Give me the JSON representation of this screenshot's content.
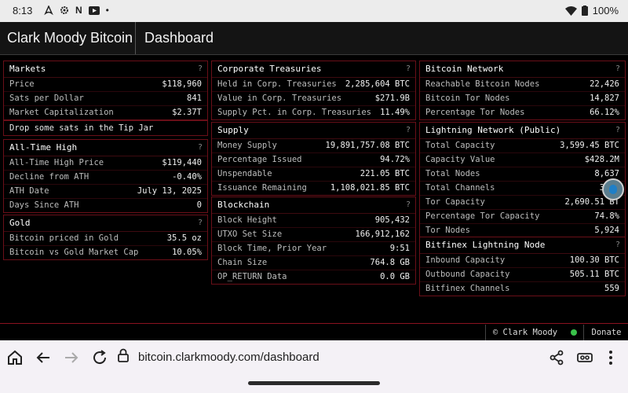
{
  "status_bar": {
    "time": "8:13",
    "left_icons": [
      "airbnb-icon",
      "settings-icon",
      "n-icon",
      "youtube-icon",
      "dot-icon"
    ],
    "battery": "100%"
  },
  "header": {
    "brand": "Clark Moody Bitcoin",
    "page": "Dashboard"
  },
  "panels": {
    "markets": {
      "title": "Markets",
      "help": "?",
      "rows": [
        {
          "label": "Price",
          "value": "$118,960"
        },
        {
          "label": "Sats per Dollar",
          "value": "841"
        },
        {
          "label": "Market Capitalization",
          "value": "$2.37T"
        }
      ]
    },
    "tip_jar": "Drop some sats in the Tip Jar",
    "ath": {
      "title": "All-Time High",
      "help": "?",
      "rows": [
        {
          "label": "All-Time High Price",
          "value": "$119,440"
        },
        {
          "label": "Decline from ATH",
          "value": "-0.40%"
        },
        {
          "label": "ATH Date",
          "value": "July 13, 2025"
        },
        {
          "label": "Days Since ATH",
          "value": "0"
        }
      ]
    },
    "gold": {
      "title": "Gold",
      "help": "?",
      "rows": [
        {
          "label": "Bitcoin priced in Gold",
          "value": "35.5 oz"
        },
        {
          "label": "Bitcoin vs Gold Market Cap",
          "value": "10.05%"
        }
      ]
    },
    "treasuries": {
      "title": "Corporate Treasuries",
      "help": "?",
      "rows": [
        {
          "label": "Held in Corp. Treasuries",
          "value": "2,285,604 BTC"
        },
        {
          "label": "Value in Corp. Treasuries",
          "value": "$271.9B"
        },
        {
          "label": "Supply Pct. in Corp. Treasuries",
          "value": "11.49%"
        }
      ]
    },
    "supply": {
      "title": "Supply",
      "help": "?",
      "rows": [
        {
          "label": "Money Supply",
          "value": "19,891,757.08 BTC"
        },
        {
          "label": "Percentage Issued",
          "value": "94.72%"
        },
        {
          "label": "Unspendable",
          "value": "221.05 BTC"
        },
        {
          "label": "Issuance Remaining",
          "value": "1,108,021.85 BTC"
        }
      ]
    },
    "blockchain": {
      "title": "Blockchain",
      "help": "?",
      "rows": [
        {
          "label": "Block Height",
          "value": "905,432"
        },
        {
          "label": "UTXO Set Size",
          "value": "166,912,162"
        },
        {
          "label": "Block Time, Prior Year",
          "value": "9:51"
        },
        {
          "label": "Chain Size",
          "value": "764.8 GB"
        },
        {
          "label": "OP_RETURN Data",
          "value": "0.0 GB"
        }
      ]
    },
    "network": {
      "title": "Bitcoin Network",
      "help": "?",
      "rows": [
        {
          "label": "Reachable Bitcoin Nodes",
          "value": "22,426"
        },
        {
          "label": "Bitcoin Tor Nodes",
          "value": "14,827"
        },
        {
          "label": "Percentage Tor Nodes",
          "value": "66.12%"
        }
      ]
    },
    "lightning": {
      "title": "Lightning Network (Public)",
      "help": "?",
      "rows": [
        {
          "label": "Total Capacity",
          "value": "3,599.45 BTC"
        },
        {
          "label": "Capacity Value",
          "value": "$428.2M"
        },
        {
          "label": "Total Nodes",
          "value": "8,637"
        },
        {
          "label": "Total Channels",
          "value": "37,6"
        },
        {
          "label": "Tor Capacity",
          "value": "2,690.51 BT"
        },
        {
          "label": "Percentage Tor Capacity",
          "value": "74.8%"
        },
        {
          "label": "Tor Nodes",
          "value": "5,924"
        }
      ]
    },
    "bitfinex": {
      "title": "Bitfinex Lightning Node",
      "help": "?",
      "rows": [
        {
          "label": "Inbound Capacity",
          "value": "100.30 BTC"
        },
        {
          "label": "Outbound Capacity",
          "value": "505.11 BTC"
        },
        {
          "label": "Bitfinex Channels",
          "value": "559"
        }
      ]
    }
  },
  "footer": {
    "credit": "© Clark Moody",
    "donate": "Donate",
    "status_color": "#3ac24a"
  },
  "browser": {
    "url": "bitcoin.clarkmoody.com/dashboard"
  }
}
